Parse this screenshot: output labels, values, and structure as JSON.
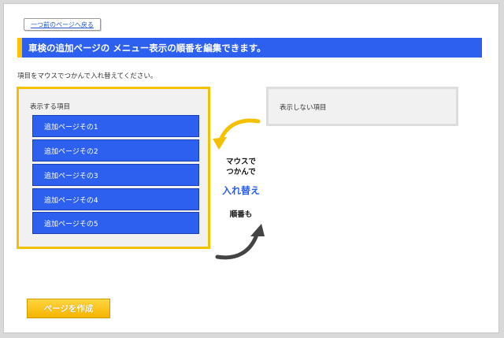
{
  "back_button": {
    "label": "一つ前のページへ戻る"
  },
  "header": {
    "title": "車検の追加ページの メニュー表示の順番を編集できます。"
  },
  "instruction": "項目をマウスでつかんで入れ替えてください。",
  "shown_section": {
    "title": "表示する項目",
    "items": [
      "追加ページその1",
      "追加ページその2",
      "追加ページその3",
      "追加ページその4",
      "追加ページその5"
    ]
  },
  "hidden_section": {
    "title": "表示しない項目"
  },
  "callout": {
    "line1": "マウスで",
    "line2": "つかんで",
    "swap": "入れ替え",
    "line3": "順番も"
  },
  "create_button": {
    "label": "ページを作成"
  },
  "colors": {
    "accent_blue": "#2d60ee",
    "accent_yellow": "#f5c000"
  }
}
